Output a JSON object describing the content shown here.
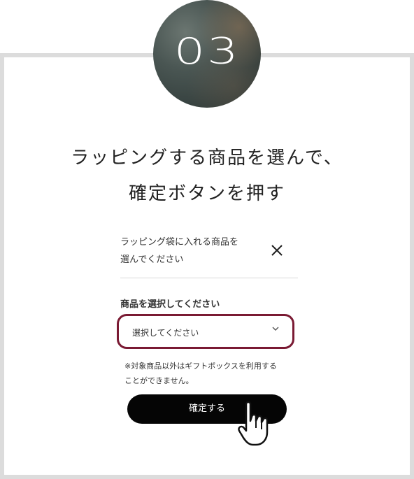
{
  "step": {
    "number": "03"
  },
  "heading": {
    "line1": "ラッピングする商品を選んで、",
    "line2": "確定ボタンを押す"
  },
  "panel": {
    "line1": "ラッピング袋に入れる商品を",
    "line2": "選んでください",
    "close_glyph": "✕"
  },
  "product_select": {
    "label": "商品を選択してください",
    "value": "選択してください",
    "chevron": "⌄"
  },
  "note": {
    "line1": "※対象商品以外はギフトボックスを利用する",
    "line2": "ことができません。"
  },
  "confirm_button": {
    "label": "確定する"
  },
  "colors": {
    "highlight": "#7a1a33",
    "button": "#050505",
    "frame": "#dcdcdc"
  },
  "icons": {
    "close": "close-icon",
    "chevron": "chevron-down-icon",
    "pointer": "hand-pointer-icon"
  }
}
